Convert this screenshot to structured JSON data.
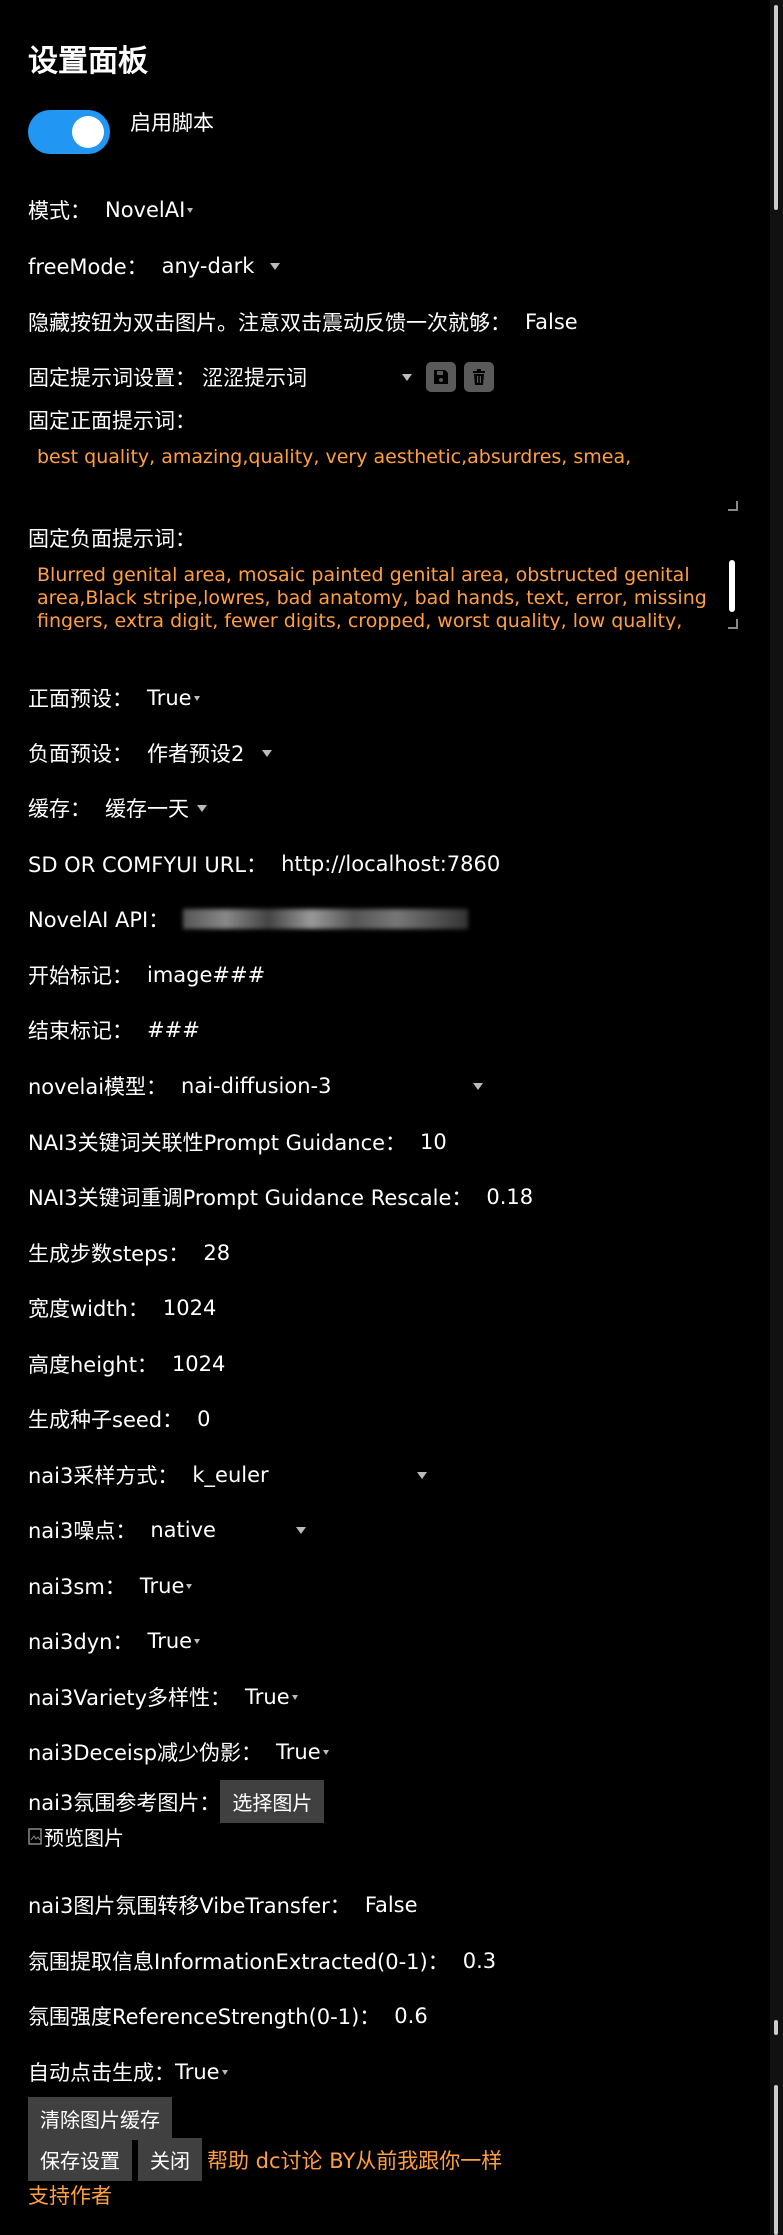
{
  "title": "设置面板",
  "enable_label": "启用脚本",
  "fields": {
    "mode": {
      "label": "模式：",
      "value": "NovelAI"
    },
    "freemode": {
      "label": "freeMode：",
      "value": "any-dark"
    },
    "hide_btn": {
      "label": "隐藏按钮为双击图片。注意双击震动反馈一次就够：",
      "value": "False"
    },
    "fixed_prompt": {
      "label": "固定提示词设置：",
      "value": "涩涩提示词"
    },
    "positive_label": "固定正面提示词：",
    "positive_text": "best quality, amazing,quality, very aesthetic,absurdres, smea,",
    "negative_label": "固定负面提示词：",
    "negative_text": "Blurred genital area, mosaic painted genital area, obstructed genital area,Black stripe,lowres, bad anatomy, bad hands, text, error, missing fingers, extra digit, fewer digits, cropped, worst quality, low quality,",
    "pos_preset": {
      "label": "正面预设：",
      "value": "True"
    },
    "neg_preset": {
      "label": "负面预设：",
      "value": "作者预设2"
    },
    "cache": {
      "label": "缓存：",
      "value": "缓存一天"
    },
    "sd_url": {
      "label": "SD OR COMFYUI URL：",
      "value": "http://localhost:7860"
    },
    "nai_api": {
      "label": "NovelAI API："
    },
    "start_mark": {
      "label": "开始标记：",
      "value": "image###"
    },
    "end_mark": {
      "label": "结束标记：",
      "value": "###"
    },
    "model": {
      "label": "novelai模型：",
      "value": "nai-diffusion-3"
    },
    "guidance": {
      "label": "NAI3关键词关联性Prompt Guidance：",
      "value": "10"
    },
    "rescale": {
      "label": "NAI3关键词重调Prompt Guidance Rescale：",
      "value": "0.18"
    },
    "steps": {
      "label": "生成步数steps：",
      "value": "28"
    },
    "width": {
      "label": "宽度width：",
      "value": "1024"
    },
    "height": {
      "label": "高度height：",
      "value": "1024"
    },
    "seed": {
      "label": "生成种子seed：",
      "value": "0"
    },
    "sampler": {
      "label": "nai3采样方式：",
      "value": "k_euler"
    },
    "noise": {
      "label": "nai3噪点：",
      "value": "native"
    },
    "sm": {
      "label": "nai3sm：",
      "value": "True"
    },
    "dyn": {
      "label": "nai3dyn：",
      "value": "True"
    },
    "variety": {
      "label": "nai3Variety多样性：",
      "value": "True"
    },
    "deceisp": {
      "label": "nai3Deceisp减少伪影：",
      "value": "True"
    },
    "vibe_img": {
      "label": "nai3氛围参考图片：",
      "button": "选择图片",
      "preview_alt": "预览图片"
    },
    "vibe": {
      "label": "nai3图片氛围转移VibeTransfer：",
      "value": "False"
    },
    "info_extracted": {
      "label": "氛围提取信息InformationExtracted(0-1)：",
      "value": "0.3"
    },
    "ref_strength": {
      "label": "氛围强度ReferenceStrength(0-1)：",
      "value": "0.6"
    },
    "auto_click": {
      "label": "自动点击生成：",
      "value": "True"
    }
  },
  "buttons": {
    "clear_cache": "清除图片缓存",
    "save": "保存设置",
    "close": "关闭"
  },
  "links": {
    "help": "帮助 dc讨论 BY从前我跟你一样",
    "support": "支持作者"
  },
  "colors": {
    "accent": "#2196f3",
    "link": "#ff9f40",
    "button": "#404040"
  }
}
